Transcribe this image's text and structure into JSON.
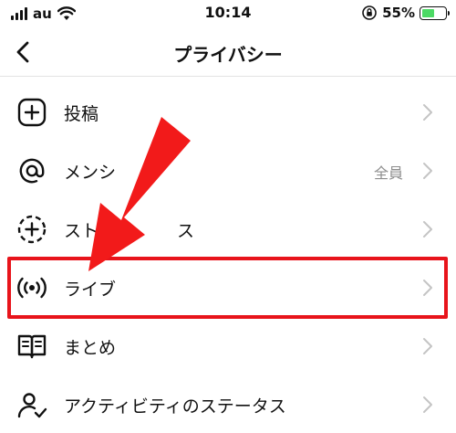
{
  "status_bar": {
    "carrier": "au",
    "time": "10:14",
    "battery_percent": "55%",
    "battery_level": 0.55,
    "battery_color": "#4cd964"
  },
  "header": {
    "title": "プライバシー",
    "back_icon": "chevron-left-icon"
  },
  "items": [
    {
      "label": "投稿",
      "icon": "plus-square-icon",
      "value": ""
    },
    {
      "label": "メンシ",
      "icon": "at-sign-icon",
      "value": "全員"
    },
    {
      "label": "スト",
      "label_tail": "ス",
      "icon": "dashed-plus-circle-icon",
      "value": ""
    },
    {
      "label": "ライブ",
      "icon": "live-broadcast-icon",
      "value": ""
    },
    {
      "label": "まとめ",
      "icon": "open-book-icon",
      "value": ""
    },
    {
      "label": "アクティビティのステータス",
      "icon": "person-check-icon",
      "value": ""
    }
  ],
  "annotation": {
    "highlight_color": "#e8141b",
    "arrow_color": "#f21a1a",
    "highlighted_item": "ライブ"
  }
}
